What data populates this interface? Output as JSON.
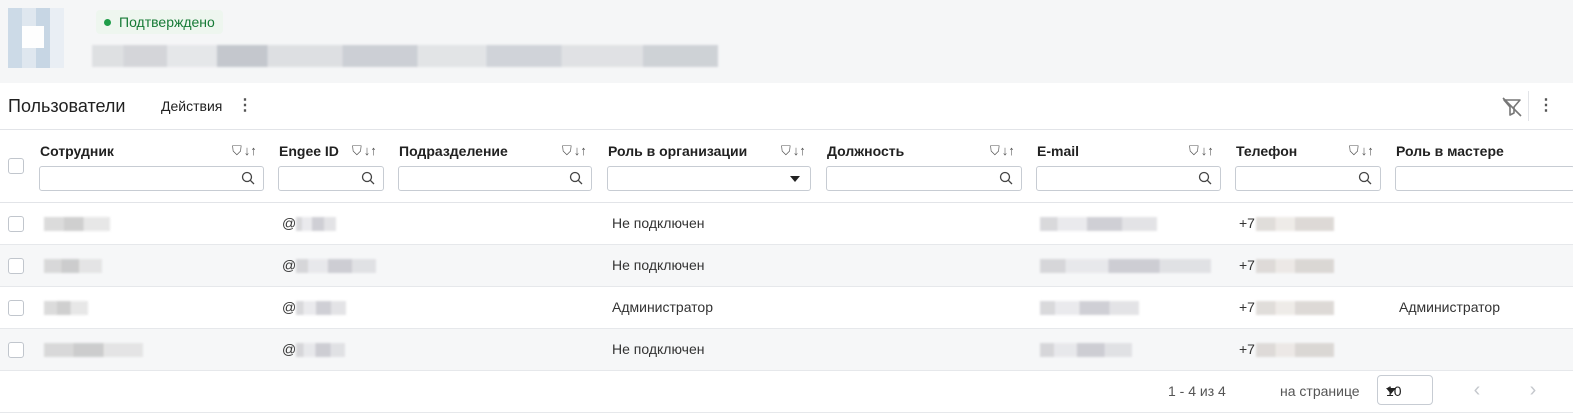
{
  "org": {
    "status": "Подтверждено"
  },
  "toolbar": {
    "title": "Пользователи",
    "actions_label": "Действия"
  },
  "columns": [
    {
      "key": "employee",
      "label": "Сотрудник",
      "filter": "search"
    },
    {
      "key": "engee_id",
      "label": "Engee ID",
      "filter": "search"
    },
    {
      "key": "department",
      "label": "Подразделение",
      "filter": "search"
    },
    {
      "key": "org_role",
      "label": "Роль в организации",
      "filter": "select"
    },
    {
      "key": "position",
      "label": "Должность",
      "filter": "search"
    },
    {
      "key": "email",
      "label": "E-mail",
      "filter": "search"
    },
    {
      "key": "phone",
      "label": "Телефон",
      "filter": "search"
    },
    {
      "key": "master_role",
      "label": "Роль в мастере",
      "filter": "search"
    }
  ],
  "rows": [
    {
      "engee_prefix": "@",
      "org_role": "Не подключен",
      "phone_prefix": "+7",
      "master_role": ""
    },
    {
      "engee_prefix": "@",
      "org_role": "Не подключен",
      "phone_prefix": "+7",
      "master_role": ""
    },
    {
      "engee_prefix": "@",
      "org_role": "Администратор",
      "phone_prefix": "+7",
      "master_role": "Администратор"
    },
    {
      "engee_prefix": "@",
      "org_role": "Не подключен",
      "phone_prefix": "+7",
      "master_role": ""
    }
  ],
  "pagination": {
    "range": "1 - 4 из 4",
    "per_page_label": "на странице",
    "per_page_value": "10"
  },
  "colors": {
    "status_dot": "#1f9d49",
    "status_text": "#167a36",
    "header_bg": "#f5f6f7",
    "row_alt_bg": "#f6f7f8"
  },
  "icons": [
    "filter-icon",
    "sort-icon",
    "search-icon",
    "chevron-down-icon",
    "more-vert-icon",
    "filter-off-icon",
    "chevron-left-icon",
    "chevron-right-icon"
  ]
}
